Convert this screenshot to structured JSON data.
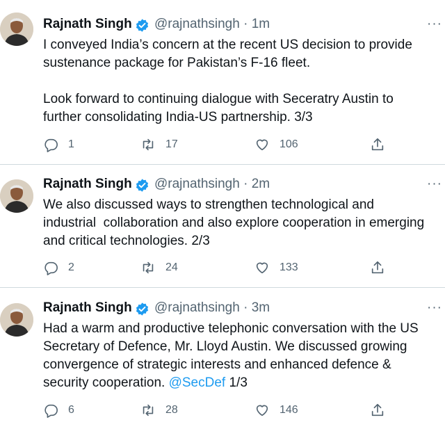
{
  "colors": {
    "link": "#1d9bf0",
    "verified": "#1d9bf0",
    "muted": "#536471"
  },
  "tweets": [
    {
      "name": "Rajnath Singh",
      "handle": "@rajnathsingh",
      "time": "1m",
      "more": "···",
      "text_main": "I conveyed India’s concern at the recent US decision to provide\nsustenance package for Pakistan’s F-16 fleet.\n\nLook forward to continuing dialogue with Seceratry Austin to\nfurther consolidating India-US partnership. 3/3",
      "mention": "",
      "text_tail": "",
      "replies": "1",
      "retweets": "17",
      "likes": "106"
    },
    {
      "name": "Rajnath Singh",
      "handle": "@rajnathsingh",
      "time": "2m",
      "more": "···",
      "text_main": "We also discussed ways to strengthen technological and\nindustrial  collaboration and also explore cooperation in emerging\nand critical technologies. 2/3",
      "mention": "",
      "text_tail": "",
      "replies": "2",
      "retweets": "24",
      "likes": "133"
    },
    {
      "name": "Rajnath Singh",
      "handle": "@rajnathsingh",
      "time": "3m",
      "more": "···",
      "text_main": "Had a warm and productive telephonic conversation with the US\nSecretary of Defence, Mr. Lloyd Austin. We discussed growing\nconvergence of strategic interests and enhanced defence &\nsecurity cooperation. ",
      "mention": "@SecDef",
      "text_tail": " 1/3",
      "replies": "6",
      "retweets": "28",
      "likes": "146"
    }
  ]
}
